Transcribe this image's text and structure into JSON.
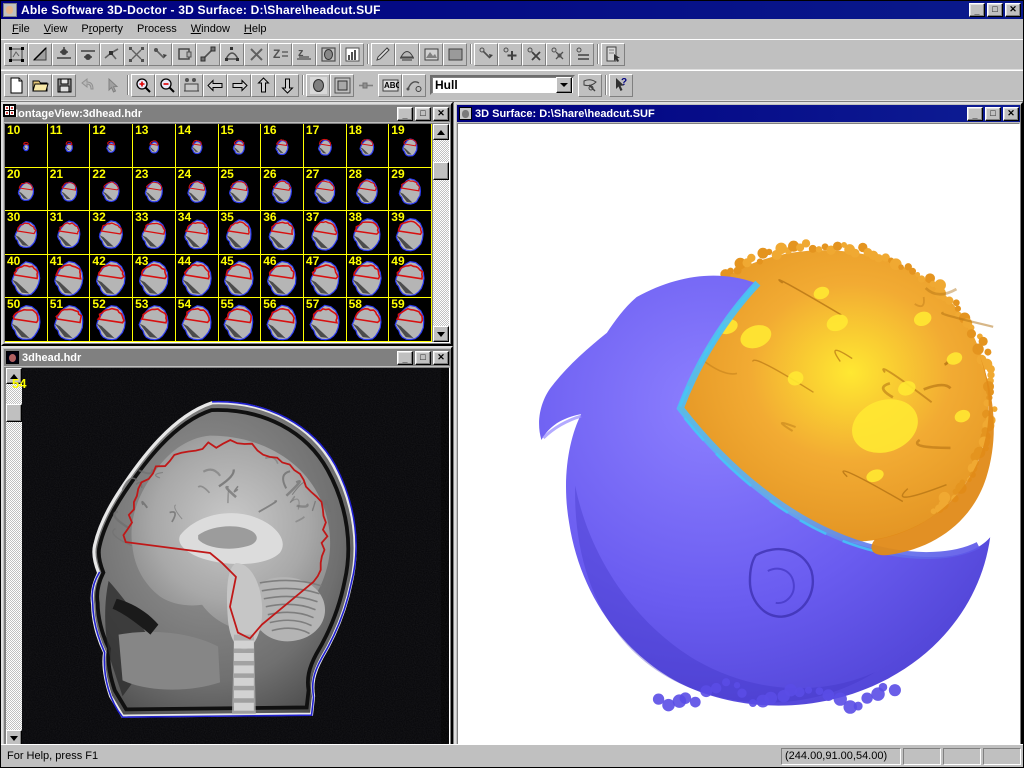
{
  "app": {
    "title": "Able Software 3D-Doctor - 3D Surface: D:\\Share\\headcut.SUF",
    "icon": "app-icon"
  },
  "window_buttons": {
    "minimize": "_",
    "maximize": "□",
    "close": "✕"
  },
  "menu": {
    "items": [
      {
        "label": "File",
        "accel": "F"
      },
      {
        "label": "View",
        "accel": "V"
      },
      {
        "label": "Property",
        "accel": "P"
      },
      {
        "label": "Process",
        "accel": "r"
      },
      {
        "label": "Window",
        "accel": "W"
      },
      {
        "label": "Help",
        "accel": "H"
      }
    ]
  },
  "toolbar_top": {
    "buttons": [
      {
        "name": "select-object-icon"
      },
      {
        "name": "draw-line-icon"
      },
      {
        "name": "add-point-icon"
      },
      {
        "name": "remove-point-icon"
      },
      {
        "name": "edit-polyline-icon"
      },
      {
        "name": "split-boundary-icon"
      },
      {
        "name": "trace-boundary-icon"
      },
      {
        "name": "rectangle-roi-icon"
      },
      {
        "name": "measure-distance-icon"
      },
      {
        "name": "measure-area-icon"
      },
      {
        "name": "delete-object-icon"
      },
      {
        "name": "z-sort-icon"
      },
      {
        "name": "z-align-icon"
      },
      {
        "name": "region-grow-icon"
      },
      {
        "name": "histogram-icon"
      },
      {
        "name": "pencil-draw-icon"
      },
      {
        "name": "surface-render-icon"
      },
      {
        "name": "image-view-icon"
      },
      {
        "name": "fill-region-icon"
      },
      {
        "name": "point-pick-icon"
      },
      {
        "name": "point-add-icon"
      },
      {
        "name": "point-delete-icon"
      },
      {
        "name": "point-move-icon"
      },
      {
        "name": "point-equal-icon"
      },
      {
        "name": "object-select-icon"
      }
    ]
  },
  "toolbar_bottom": {
    "buttons": [
      {
        "name": "new-file-icon"
      },
      {
        "name": "open-file-icon"
      },
      {
        "name": "save-file-icon"
      },
      {
        "name": "undo-icon"
      },
      {
        "name": "arrow-pointer-icon"
      },
      {
        "name": "zoom-in-icon"
      },
      {
        "name": "zoom-out-icon"
      },
      {
        "name": "pan-camera-icon"
      },
      {
        "name": "previous-slice-icon"
      },
      {
        "name": "next-slice-icon"
      },
      {
        "name": "slice-up-icon"
      },
      {
        "name": "slice-down-icon"
      },
      {
        "name": "brain-object-icon"
      },
      {
        "name": "montage-view-icon"
      },
      {
        "name": "threshold-icon"
      },
      {
        "name": "abc-label-icon"
      },
      {
        "name": "vector-edit-icon"
      }
    ],
    "combo": {
      "name": "object-select-combo",
      "value": "Hull"
    },
    "after_combo": [
      {
        "name": "object-properties-icon"
      },
      {
        "name": "context-help-icon"
      }
    ]
  },
  "montage_window": {
    "title": "MontageView:3dhead.hdr",
    "active": false,
    "icon": "montage-window-icon",
    "columns": 10,
    "rows": 5,
    "slices": [
      10,
      11,
      12,
      13,
      14,
      15,
      16,
      17,
      18,
      19,
      20,
      21,
      22,
      23,
      24,
      25,
      26,
      27,
      28,
      29,
      30,
      31,
      32,
      33,
      34,
      35,
      36,
      37,
      38,
      39,
      40,
      41,
      42,
      43,
      44,
      45,
      46,
      47,
      48,
      49,
      50,
      51,
      52,
      53,
      54,
      55,
      56,
      57,
      58,
      59
    ],
    "grid_color": "#ffff00",
    "number_color": "#ffff00",
    "boundary_colors": {
      "brain": "#d81010",
      "skin": "#3040ff"
    }
  },
  "slice_window": {
    "title": "3dhead.hdr",
    "active": false,
    "icon": "slice-window-icon",
    "slice_number": "54",
    "slice_number_color": "#ffff00",
    "contours": {
      "brain_outline": "#c01818",
      "skin_outline": "#2020d0"
    }
  },
  "surface_window": {
    "title": "3D Surface: D:\\Share\\headcut.SUF",
    "active": true,
    "icon": "surface-window-icon",
    "background": "#ffffff",
    "objects": [
      {
        "name": "Brain",
        "color": "#e8962c",
        "highlight": "#ffe832"
      },
      {
        "name": "Hull",
        "color": "#6a5cf0",
        "highlight": "#44c8f8"
      }
    ]
  },
  "statusbar": {
    "hint": "For Help, press F1",
    "coordinates": "(244.00,91.00,54.00)",
    "pane2": "",
    "pane3": "",
    "pane4": ""
  }
}
